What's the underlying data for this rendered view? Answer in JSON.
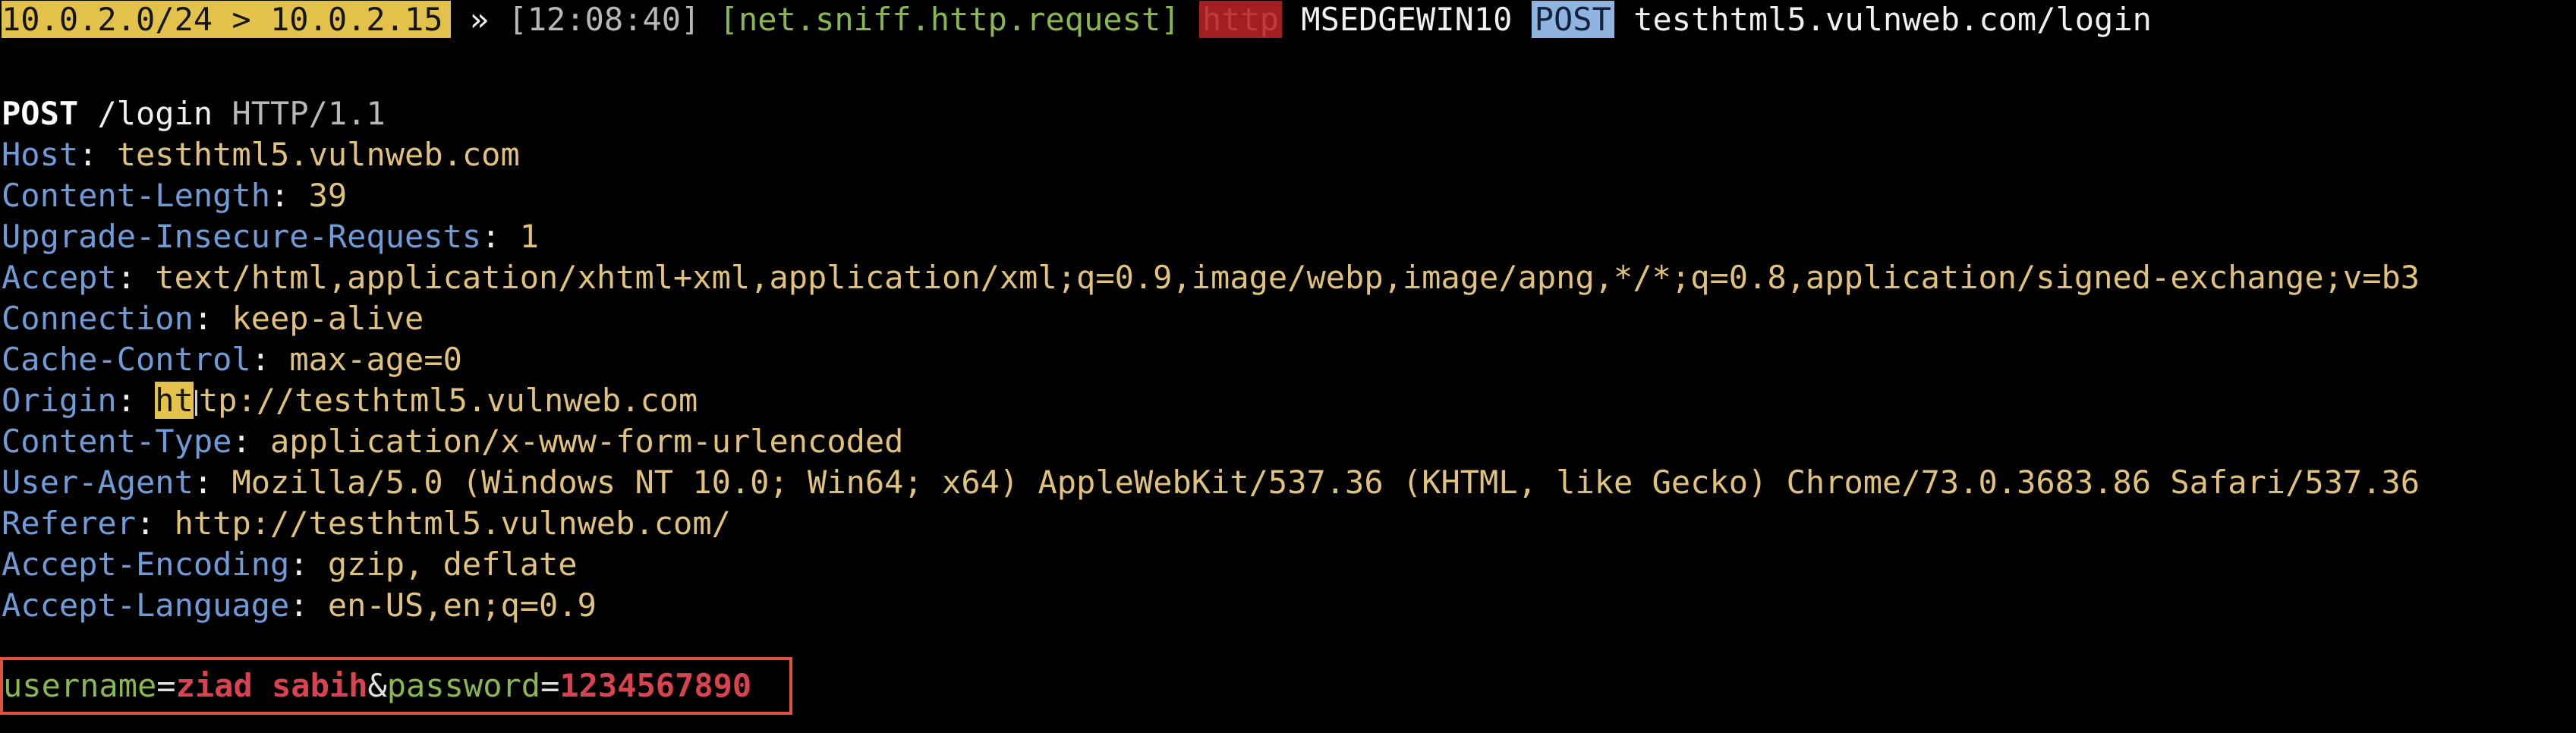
{
  "terminal": {
    "top_bar": {
      "target": "10.0.2.0/24 > 10.0.2.15",
      "arrow": "»",
      "timestamp": "[12:08:40]",
      "module": "[net.sniff.http.request]",
      "proto_badge": "http",
      "host_name": "MSEDGEWIN10",
      "method_badge": "POST",
      "url": "testhtml5.vulnweb.com/login"
    },
    "request_line": {
      "method": "POST",
      "path": "/login",
      "version": "HTTP/1.1"
    },
    "headers": [
      {
        "name": "Host",
        "value": "testhtml5.vulnweb.com"
      },
      {
        "name": "Content-Length",
        "value": "39"
      },
      {
        "name": "Upgrade-Insecure-Requests",
        "value": "1"
      },
      {
        "name": "Accept",
        "value": "text/html,application/xhtml+xml,application/xml;q=0.9,image/webp,image/apng,*/*;q=0.8,application/signed-exchange;v=b3"
      },
      {
        "name": "Connection",
        "value": "keep-alive"
      },
      {
        "name": "Cache-Control",
        "value": "max-age=0"
      },
      {
        "name": "Origin",
        "value_highlighted": "ht",
        "value_rest": "tp://testhtml5.vulnweb.com"
      },
      {
        "name": "Content-Type",
        "value": "application/x-www-form-urlencoded"
      },
      {
        "name": "User-Agent",
        "value": "Mozilla/5.0 (Windows NT 10.0; Win64; x64) AppleWebKit/537.36 (KHTML, like Gecko) Chrome/73.0.3683.86 Safari/537.36"
      },
      {
        "name": "Referer",
        "value": "http://testhtml5.vulnweb.com/"
      },
      {
        "name": "Accept-Encoding",
        "value": "gzip, deflate"
      },
      {
        "name": "Accept-Language",
        "value": "en-US,en;q=0.9"
      }
    ],
    "form_body": {
      "username_key": "username",
      "eq1": "=",
      "username_value": "ziad sabih",
      "amp": "&",
      "password_key": "password",
      "eq2": "=",
      "password_value": "1234567890"
    },
    "colors": {
      "background": "#000000",
      "header_name": "#6f9bd8",
      "header_value": "#e0c27a",
      "form_key": "#89b84e",
      "form_value": "#d9434f",
      "highlight_box": "#e0523d"
    }
  }
}
